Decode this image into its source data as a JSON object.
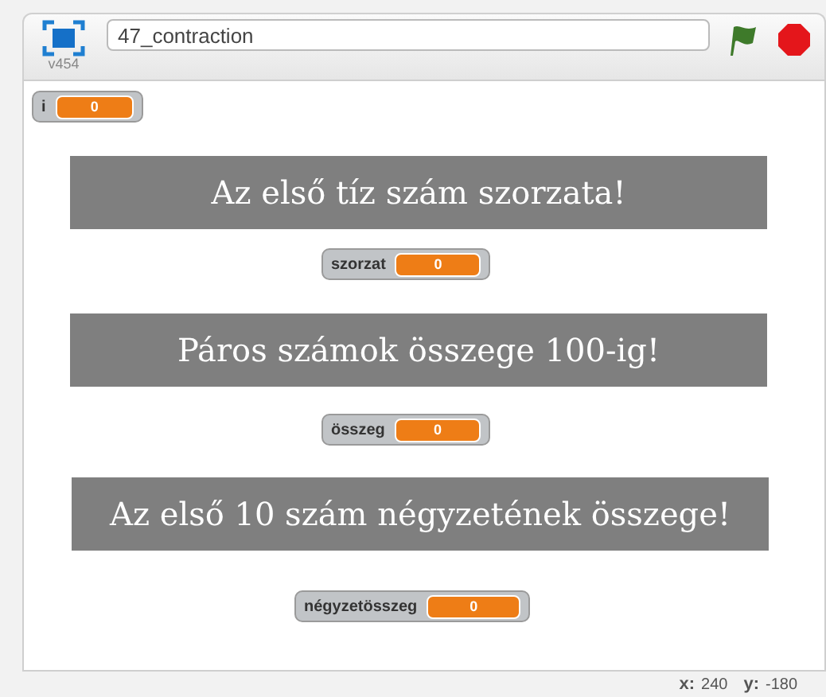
{
  "player": {
    "project_title": "47_contraction",
    "version": "v454"
  },
  "stage": {
    "monitors": [
      {
        "label": "i",
        "value": "0"
      },
      {
        "label": "szorzat",
        "value": "0"
      },
      {
        "label": "összeg",
        "value": "0"
      },
      {
        "label": "négyzetösszeg",
        "value": "0"
      }
    ],
    "banners": [
      {
        "text": "Az első tíz szám szorzata!"
      },
      {
        "text": "Páros számok összege 100-ig!"
      },
      {
        "text": "Az első 10 szám négyzetének összege!"
      }
    ]
  },
  "footer": {
    "x_label": "x:",
    "x_value": "240",
    "y_label": "y:",
    "y_value": "-180"
  }
}
